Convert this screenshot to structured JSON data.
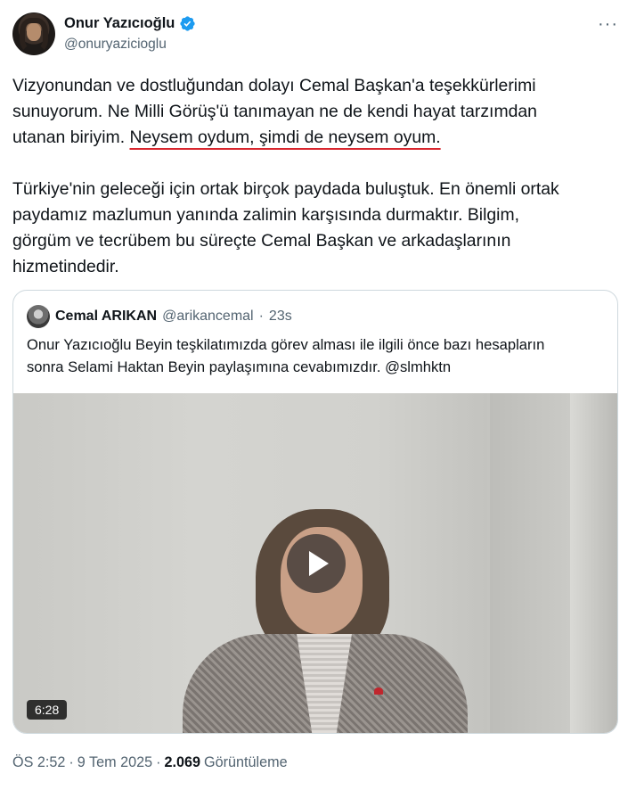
{
  "author": {
    "display_name": "Onur Yazıcıoğlu",
    "handle": "@onuryazicioglu",
    "verified": true
  },
  "more_icon": "···",
  "body": {
    "line1": "Vizyonundan ve dostluğundan dolayı Cemal Başkan'a teşekkürlerimi",
    "line2": "sunuyorum. Ne Milli Görüş'ü tanımayan ne de kendi hayat tarzımdan",
    "line3_start": "utanan biriyim. ",
    "line3_underlined": "Neysem oydum, şimdi de neysem oyum.",
    "para2_line1": "Türkiye'nin geleceği için ortak birçok paydada buluştuk. En önemli ortak",
    "para2_line2": "paydamız mazlumun yanında zalimin karşısında durmaktır. Bilgim,",
    "para2_line3": "görgüm ve tecrübem bu süreçte Cemal Başkan ve arkadaşlarının",
    "para2_line4": "hizmetindedir."
  },
  "quote": {
    "display_name": "Cemal ARIKAN",
    "handle": "@arikancemal",
    "separator": "·",
    "time": "23s",
    "line1": "Onur Yazıcıoğlu Beyin teşkilatımızda görev alması ile ilgili önce bazı hesapların",
    "line2": "sonra Selami Haktan Beyin paylaşımına cevabımızdır. @slmhktn",
    "video": {
      "duration": "6:28"
    }
  },
  "footer": {
    "time": "ÖS 2:52",
    "separator1": "·",
    "date": "9 Tem 2025",
    "separator2": "·",
    "views": "2.069",
    "views_label": "Görüntüleme"
  },
  "colors": {
    "verified_blue": "#1d9bf0",
    "underline_red": "#d8262e",
    "secondary_text": "#536471"
  }
}
